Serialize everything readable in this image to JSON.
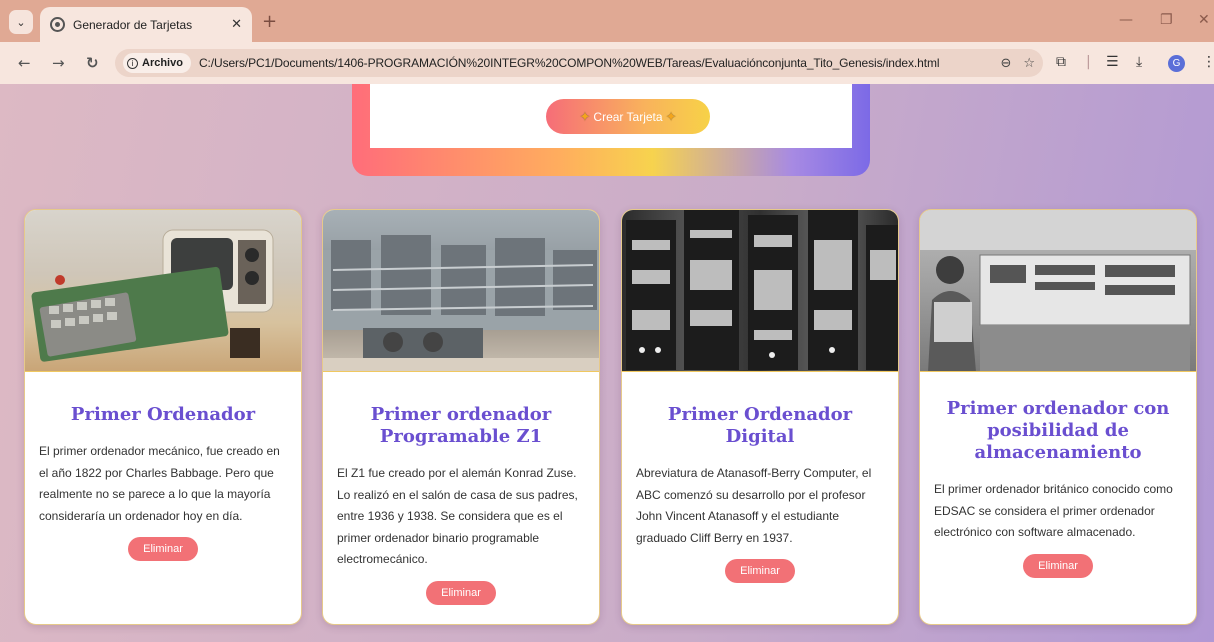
{
  "browser": {
    "tab_title": "Generador de Tarjetas",
    "address_chip": "Archivo",
    "url": "C:/Users/PC1/Documents/1406-PROGRAMACIÓN%20INTEGR%20COMPON%20WEB/Tareas/Evaluaciónconjunta_Tito_Genesis/index.html",
    "profile_initial": "G"
  },
  "form": {
    "create_button_label": "Crear Tarjeta"
  },
  "cards": [
    {
      "title": "Primer Ordenador",
      "text": "El primer ordenador mecánico, fue creado en el año 1822 por Charles Babbage. Pero que realmente no se parece a lo que la mayoría consideraría un ordenador hoy en día.",
      "delete_label": "Eliminar"
    },
    {
      "title": "Primer ordenador Programable Z1",
      "text": "El Z1 fue creado por el alemán Konrad Zuse. Lo realizó en el salón de casa de sus padres, entre 1936 y 1938. Se considera que es el primer ordenador binario programable electromecánico.",
      "delete_label": "Eliminar"
    },
    {
      "title": "Primer Ordenador Digital",
      "text": "Abreviatura de Atanasoff-Berry Computer, el ABC comenzó su desarrollo por el profesor John Vincent Atanasoff y el estudiante graduado Cliff Berry en 1937.",
      "delete_label": "Eliminar"
    },
    {
      "title": "Primer ordenador con posibilidad de almacenamiento",
      "text": "El primer ordenador británico conocido como EDSAC se considera el primer ordenador electrónico con software almacenado.",
      "delete_label": "Eliminar"
    }
  ],
  "colors": {
    "card_title": "#6a4fd0",
    "delete_button": "#f27176",
    "tab_bar": "#e0a994"
  }
}
